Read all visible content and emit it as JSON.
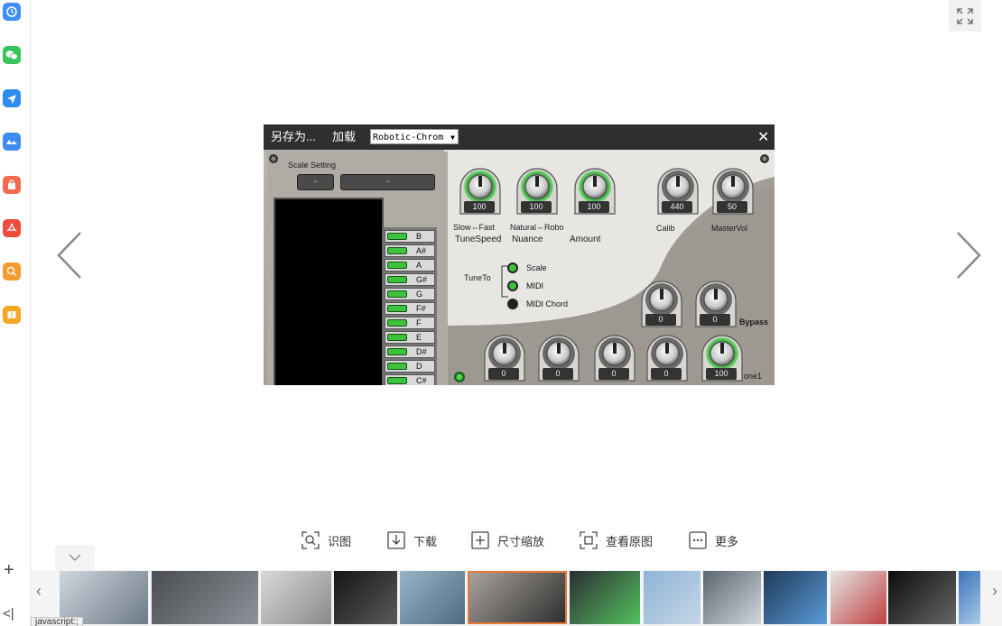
{
  "plugin": {
    "save_as": "另存为...",
    "load": "加载",
    "preset": "Robotic-Chrom",
    "scale_setting": "Scale Setting",
    "scale_btn1": "-",
    "scale_btn2": "-",
    "notes": [
      "B",
      "A#",
      "A",
      "G#",
      "G",
      "F#",
      "F",
      "E",
      "D#",
      "D",
      "C#"
    ],
    "knobs_top": [
      {
        "value": "100",
        "label1": "Slow⇔Fast",
        "label2": "TuneSpeed"
      },
      {
        "value": "100",
        "label1": "Natural⇔Robo",
        "label2": "Nuance"
      },
      {
        "value": "100",
        "label1": "",
        "label2": "Amount"
      }
    ],
    "knobs_right": [
      {
        "value": "440",
        "label": "Calib"
      },
      {
        "value": "50",
        "label": "MasterVol"
      }
    ],
    "tune_to_label": "TuneTo",
    "tune_to_options": [
      "Scale",
      "MIDI",
      "MIDI Chord"
    ],
    "bypass_knobs": [
      "0",
      "0"
    ],
    "bypass_label": "Bypass",
    "bottom_knobs": [
      "0",
      "0",
      "0",
      "0",
      "100"
    ],
    "bottom_label": "one1"
  },
  "toolbar": {
    "identify": "识图",
    "download": "下载",
    "resize": "尺寸缩放",
    "original": "查看原图",
    "more": "更多"
  },
  "status_tip": "javascript:;",
  "colors": {
    "accent_orange": "#e8773a",
    "led_green": "#3cc23c",
    "plugin_gray": "#a7a29b"
  }
}
